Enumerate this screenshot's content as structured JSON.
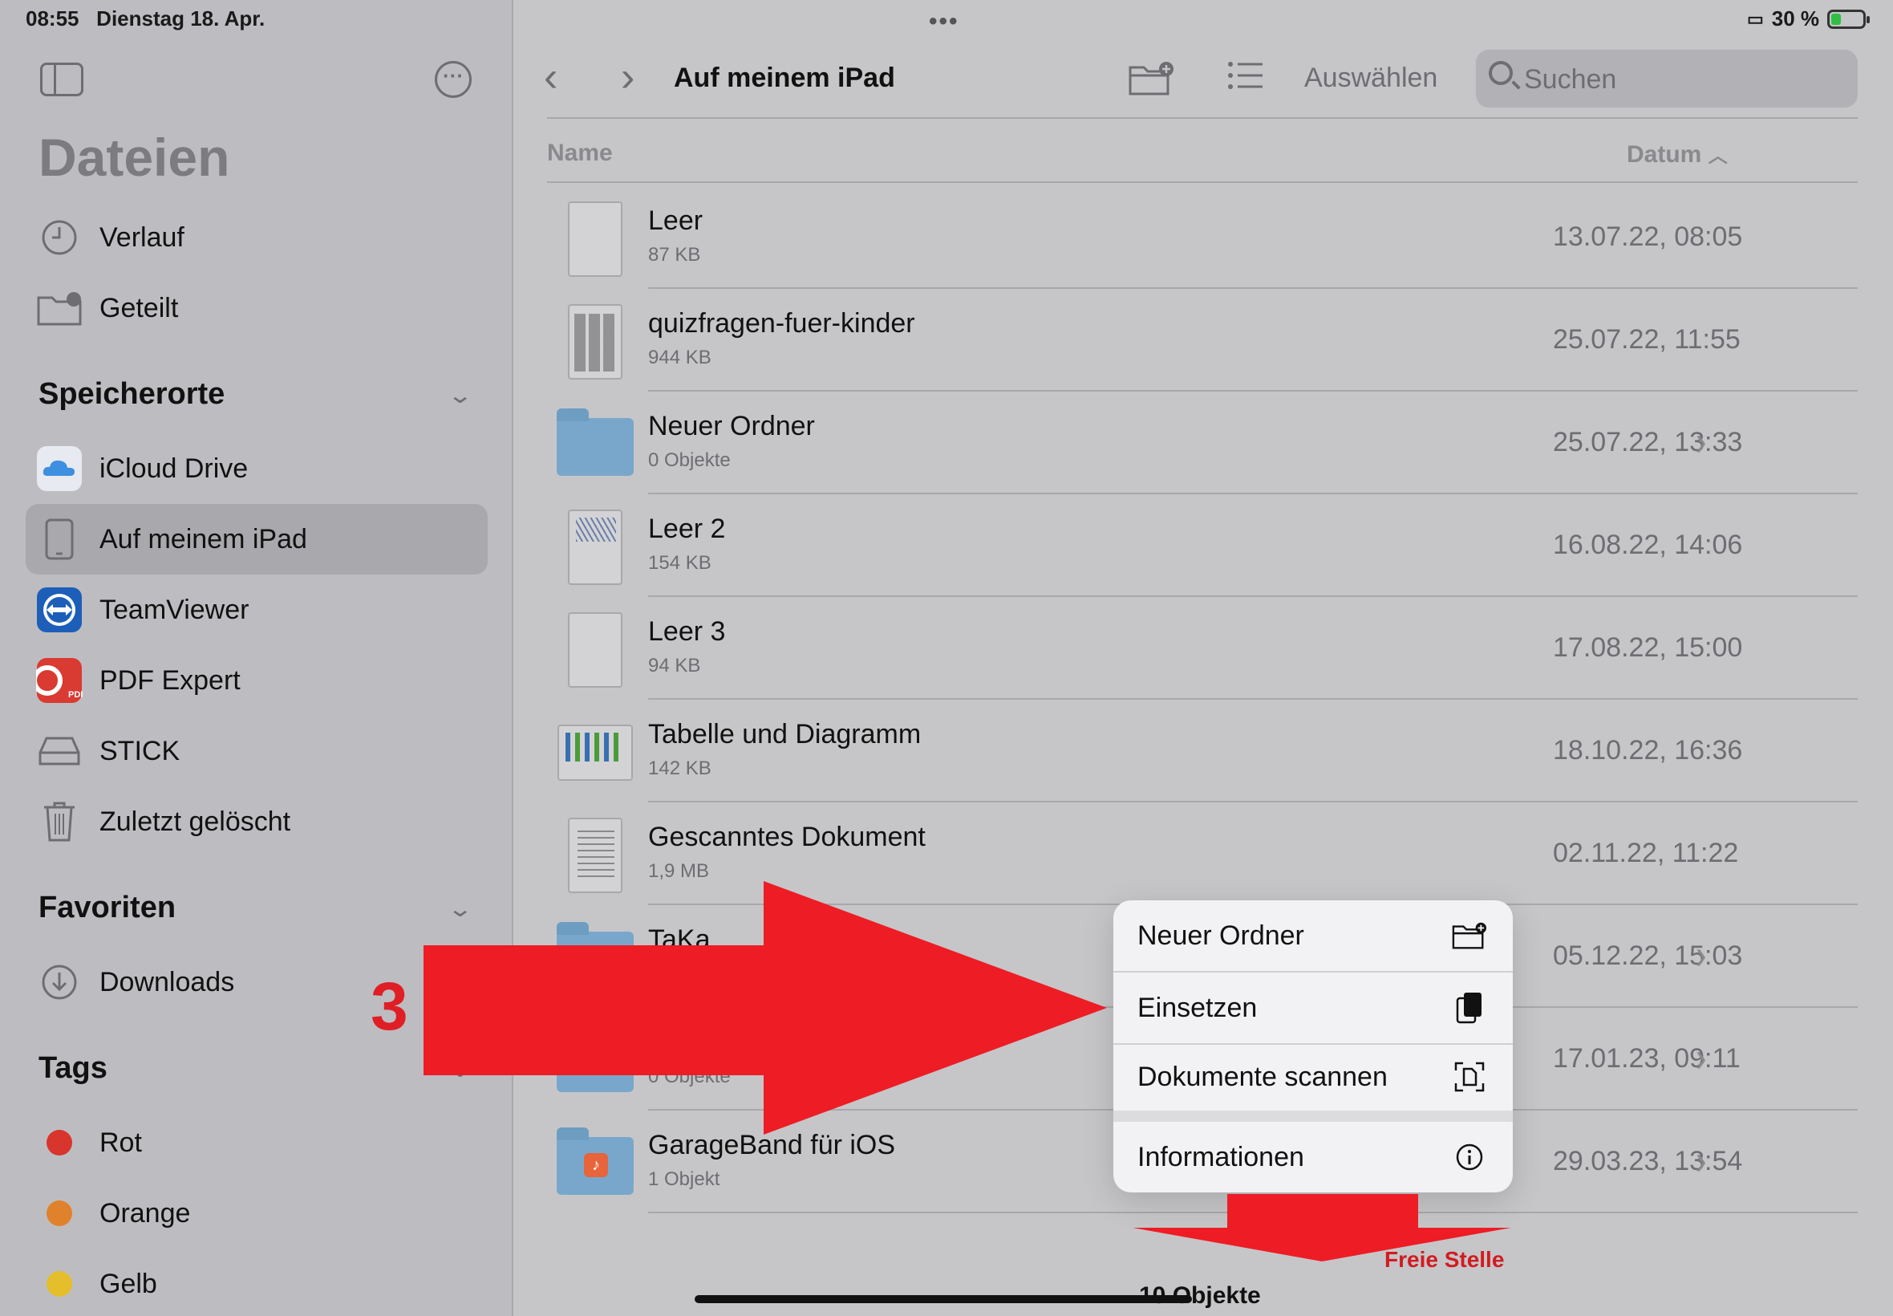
{
  "status": {
    "time": "08:55",
    "date": "Dienstag 18. Apr.",
    "battery": "30 %",
    "battery_level": 0.3,
    "more": "•••"
  },
  "sidebar": {
    "title": "Dateien",
    "top_items": [
      {
        "label": "Verlauf",
        "icon": "clock-icon"
      },
      {
        "label": "Geteilt",
        "icon": "shared-folder-icon"
      }
    ],
    "locations_title": "Speicherorte",
    "locations": [
      {
        "label": "iCloud Drive",
        "icon": "icloud-icon"
      },
      {
        "label": "Auf meinem iPad",
        "icon": "ipad-icon",
        "selected": true
      },
      {
        "label": "TeamViewer",
        "icon": "teamviewer-icon"
      },
      {
        "label": "PDF Expert",
        "icon": "pdf-expert-icon"
      },
      {
        "label": "STICK",
        "icon": "drive-icon"
      },
      {
        "label": "Zuletzt gelöscht",
        "icon": "trash-icon"
      }
    ],
    "favorites_title": "Favoriten",
    "favorites": [
      {
        "label": "Downloads",
        "icon": "download-icon"
      }
    ],
    "tags_title": "Tags",
    "tags": [
      {
        "label": "Rot",
        "color": "#d8352d"
      },
      {
        "label": "Orange",
        "color": "#e0822b"
      },
      {
        "label": "Gelb",
        "color": "#e4be2b"
      }
    ]
  },
  "toolbar": {
    "title": "Auf meinem iPad",
    "select_label": "Auswählen",
    "search_placeholder": "Suchen"
  },
  "columns": {
    "name": "Name",
    "date": "Datum"
  },
  "files": [
    {
      "name": "Leer",
      "meta": "87 KB",
      "date": "13.07.22, 08:05",
      "kind": "doc"
    },
    {
      "name": "quizfragen-fuer-kinder",
      "meta": "944 KB",
      "date": "25.07.22, 11:55",
      "kind": "grid"
    },
    {
      "name": "Neuer Ordner",
      "meta": "0 Objekte",
      "date": "25.07.22, 13:33",
      "kind": "folder"
    },
    {
      "name": "Leer 2",
      "meta": "154 KB",
      "date": "16.08.22, 14:06",
      "kind": "scrib"
    },
    {
      "name": "Leer 3",
      "meta": "94 KB",
      "date": "17.08.22, 15:00",
      "kind": "doc"
    },
    {
      "name": "Tabelle und Diagramm",
      "meta": "142 KB",
      "date": "18.10.22, 16:36",
      "kind": "chart"
    },
    {
      "name": "Gescanntes Dokument",
      "meta": "1,9 MB",
      "date": "02.11.22, 11:22",
      "kind": "lines"
    },
    {
      "name": "TaKa",
      "meta": "",
      "date": "05.12.22, 15:03",
      "kind": "folder"
    },
    {
      "name": "",
      "meta": "0 Objekte",
      "date": "17.01.23, 09:11",
      "kind": "folder"
    },
    {
      "name": "GarageBand für iOS",
      "meta": "1 Objekt",
      "date": "29.03.23, 13:54",
      "kind": "folder-app"
    }
  ],
  "footer": {
    "count": "10 Objekte"
  },
  "context_menu": [
    {
      "label": "Neuer Ordner",
      "icon": "new-folder-icon"
    },
    {
      "label": "Einsetzen",
      "icon": "paste-icon"
    },
    {
      "label": "Dokumente scannen",
      "icon": "scan-document-icon"
    },
    {
      "label": "Informationen",
      "icon": "info-icon"
    }
  ],
  "annotations": {
    "step_number": "3",
    "free_spot_label": "Freie Stelle",
    "arrow_color": "#ee1c25"
  }
}
